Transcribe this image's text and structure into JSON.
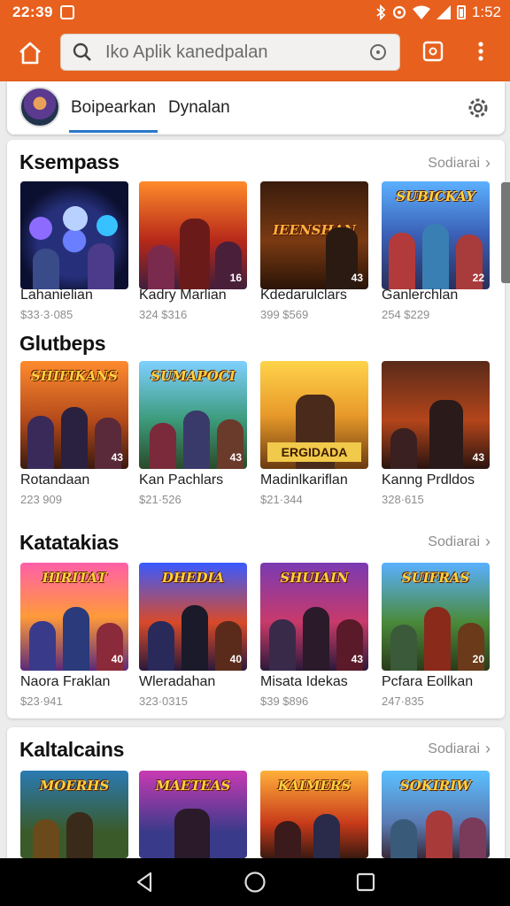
{
  "status_bar": {
    "time": "22:39",
    "clock_right": "1:52",
    "icons": [
      "app-notification-icon",
      "bluetooth-icon",
      "sync-icon",
      "wifi-icon",
      "signal-icon",
      "battery-icon"
    ]
  },
  "toolbar": {
    "search_placeholder": "Iko Aplik kanedpalan",
    "icons": [
      "home-icon",
      "search-icon",
      "mic-icon",
      "tabs-icon",
      "overflow-menu-icon"
    ],
    "accent": "#e8601e"
  },
  "tabs": [
    {
      "label": "Boipearkan",
      "active": true
    },
    {
      "label": "Dynalan",
      "active": false
    }
  ],
  "sections": [
    {
      "title": "Ksempass",
      "more": "Sodiarai",
      "items": [
        {
          "name": "Lahanielian",
          "price": "$33·3·085",
          "art": "",
          "badge": ""
        },
        {
          "name": "Kadry Marlian",
          "price": "324 $316",
          "art": "",
          "badge": "16"
        },
        {
          "name": "Kdedarulclars",
          "price": "399 $569",
          "art": "IEENSHAN",
          "badge": "43"
        },
        {
          "name": "Ganlerchlan",
          "price": "254 $229",
          "art": "SUBICKAY",
          "badge": "22"
        }
      ]
    },
    {
      "title": "Glutbeps",
      "more": "",
      "items": [
        {
          "name": "Rotandaan",
          "price": "223 909",
          "art": "SHIFIKANS",
          "badge": "43"
        },
        {
          "name": "Kan Pachlars",
          "price": "$21·526",
          "art": "SUMAPOCI",
          "badge": "43"
        },
        {
          "name": "Madinlkariflan",
          "price": "$21·344",
          "art": "ERGIDADA",
          "badge": ""
        },
        {
          "name": "Kanng Prdldos",
          "price": "328·615",
          "art": "",
          "badge": "43"
        }
      ]
    },
    {
      "title": "Katatakias",
      "more": "Sodiarai",
      "items": [
        {
          "name": "Naora Fraklan",
          "price": "$23·941",
          "art": "HIRITAT",
          "badge": "40"
        },
        {
          "name": "Wleradahan",
          "price": "323·0315",
          "art": "DHEDIA",
          "badge": "40"
        },
        {
          "name": "Misata Idekas",
          "price": "$39 $896",
          "art": "SHUIAIN",
          "badge": "43"
        },
        {
          "name": "Pcfara Eollkan",
          "price": "247·835",
          "art": "SUIFRAS",
          "badge": "20"
        }
      ]
    },
    {
      "title": "Kaltalcains",
      "more": "Sodiarai",
      "items": [
        {
          "name": "",
          "price": "",
          "art": "MOERHS",
          "badge": ""
        },
        {
          "name": "",
          "price": "",
          "art": "MAETEAS",
          "badge": ""
        },
        {
          "name": "",
          "price": "",
          "art": "KAIMERS",
          "badge": ""
        },
        {
          "name": "",
          "price": "",
          "art": "SOKIRIW",
          "badge": ""
        }
      ]
    }
  ],
  "nav_bar": {
    "icons": [
      "back-icon",
      "home-circle-icon",
      "recents-icon"
    ]
  }
}
